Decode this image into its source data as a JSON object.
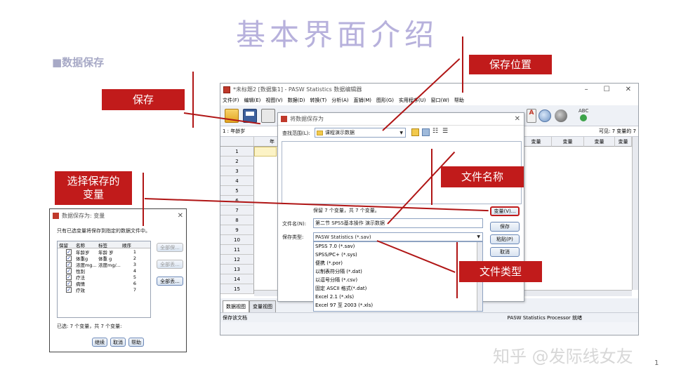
{
  "slide": {
    "title": "基本界面介绍",
    "section": "■数据保存",
    "page_number": "1",
    "watermark": "知乎 @发际线女友"
  },
  "callouts": {
    "save": "保存",
    "save_location": "保存位置",
    "file_name": "文件名称",
    "select_vars_line1": "选择保存的",
    "select_vars_line2": "变量",
    "file_type": "文件类型"
  },
  "editor": {
    "title": "*未标题2 [数据集1] - PASW Statistics 数据编辑器",
    "menu": [
      "文件(F)",
      "编辑(E)",
      "视图(V)",
      "数据(D)",
      "转换(T)",
      "分析(A)",
      "直销(M)",
      "图形(G)",
      "实用程序(U)",
      "窗口(W)",
      "帮助"
    ],
    "cell_ref": "1 : 年龄岁",
    "visible_text": "可见: 7 变量的 7",
    "col_partial": "年",
    "col_headers": [
      "变量",
      "变量",
      "变量",
      "变量"
    ],
    "rows": [
      "1",
      "2",
      "3",
      "4",
      "5",
      "6",
      "7",
      "8",
      "9",
      "10",
      "11",
      "12",
      "13",
      "14",
      "15"
    ],
    "tab_data": "数据视图",
    "tab_var": "变量视图",
    "status_left": "保存该文档",
    "status_right": "PASW Statistics Processor 就绪"
  },
  "save_dialog": {
    "title": "将数据保存为",
    "look_in_label": "查找范围(L):",
    "look_in_value": "课程演示数据",
    "keep_text": "保留 7 个变量，共 7 个变量。",
    "filename_label": "文件名(N):",
    "filename_value": "第二节 SPSS基本操作 演示数据",
    "type_label": "保存类型:",
    "type_value": "PASW Statistics (*.sav)",
    "type_options": [
      "SPSS 7.0 (*.sav)",
      "SPSS/PC+ (*.sys)",
      "便携 (*.por)",
      "以制表符分隔 (*.dat)",
      "以逗号分隔 (*.csv)",
      "固定 ASCII 格式(*.dat)",
      "Excel 2.1 (*.xls)",
      "Excel 97 至 2003 (*.xls)"
    ],
    "buttons": [
      "变量(V)...",
      "保存",
      "粘贴(P)",
      "取消"
    ]
  },
  "vars_dialog": {
    "title": "数据保存为: 变量",
    "instruction": "只有已选变量将保存到指定的数据文件中。",
    "headers": [
      "保留",
      "名称",
      "标签",
      "顺序"
    ],
    "rows": [
      {
        "name": "年龄岁",
        "label": "年龄 岁",
        "order": "1"
      },
      {
        "name": "体重g",
        "label": "体重 g",
        "order": "2"
      },
      {
        "name": "浓度mg...",
        "label": "浓度mg/...",
        "order": "3"
      },
      {
        "name": "性别",
        "label": "",
        "order": "4"
      },
      {
        "name": "疗法",
        "label": "",
        "order": "5"
      },
      {
        "name": "病情",
        "label": "",
        "order": "6"
      },
      {
        "name": "疗效",
        "label": "",
        "order": "7"
      }
    ],
    "side_buttons": [
      "全部保...",
      "全部丢...",
      "全部丢..."
    ],
    "selected_text": "已选: 7 个变量，共 7 个变量:",
    "bottom_buttons": [
      "继续",
      "取消",
      "帮助"
    ]
  },
  "colors": {
    "accent_red": "#c11b1b",
    "title_lavender": "#b7b1dc"
  }
}
